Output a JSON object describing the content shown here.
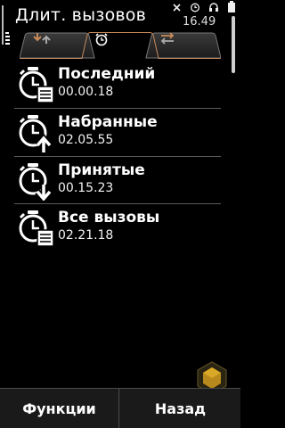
{
  "header": {
    "title": "Длит. вызовов",
    "time": "16.49",
    "status_icons": [
      "close-icon",
      "alarm-icon",
      "headset-icon",
      "battery-icon"
    ]
  },
  "tabs": [
    {
      "name": "last-call-tab",
      "icon": "call-arrows-icon",
      "selected": false
    },
    {
      "name": "call-duration-tab",
      "icon": "stopwatch-icon",
      "selected": true
    },
    {
      "name": "data-counter-tab",
      "icon": "transfer-arrows-icon",
      "selected": false
    }
  ],
  "items": [
    {
      "label": "Последний",
      "value": "00.00.18",
      "icon": "stopwatch-list-icon"
    },
    {
      "label": "Набранные",
      "value": "02.05.55",
      "icon": "stopwatch-outgoing-icon"
    },
    {
      "label": "Принятые",
      "value": "00.15.23",
      "icon": "stopwatch-incoming-icon"
    },
    {
      "label": "Все вызовы",
      "value": "02.21.18",
      "icon": "stopwatch-all-icon"
    }
  ],
  "softkeys": {
    "left": "Функции",
    "right": "Назад"
  },
  "colors": {
    "background": "#000000",
    "tab_accent": "#c88a5a",
    "separator": "#5a5a5a"
  }
}
